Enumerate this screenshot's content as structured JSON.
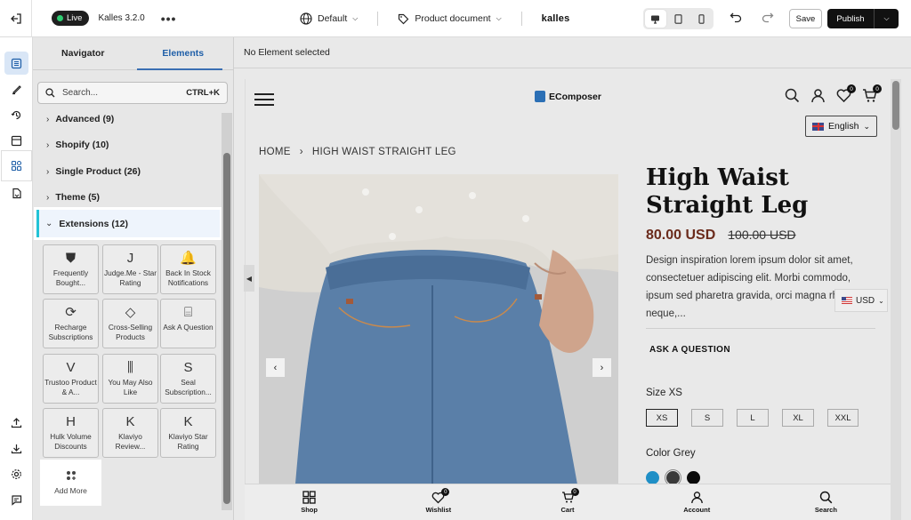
{
  "topbar": {
    "live_label": "Live",
    "theme_name": "Kalles 3.2.0",
    "more_label": "•••",
    "language_label": "Default",
    "page_label": "Product document",
    "brand_logo": "kalles",
    "save_label": "Save",
    "publish_label": "Publish"
  },
  "panel": {
    "tabs": [
      "Navigator",
      "Elements"
    ],
    "active_tab": "Elements",
    "search_placeholder": "Search...",
    "search_shortcut": "CTRL+K",
    "categories": [
      {
        "label": "Advanced (9)"
      },
      {
        "label": "Shopify (10)"
      },
      {
        "label": "Single Product (26)"
      },
      {
        "label": "Theme (5)"
      },
      {
        "label": "Extensions (12)"
      }
    ],
    "tiles": [
      {
        "label": "Frequently Bought...",
        "icon": "shield-icon",
        "glyph": "⛊"
      },
      {
        "label": "Judge.Me - Star Rating",
        "icon": "judgeme-icon",
        "glyph": "J"
      },
      {
        "label": "Back In Stock Notifications",
        "icon": "bell-icon",
        "glyph": "🔔"
      },
      {
        "label": "Recharge Subscriptions",
        "icon": "refresh-icon",
        "glyph": "⟳"
      },
      {
        "label": "Cross-Selling Products",
        "icon": "tag-icon",
        "glyph": "◇"
      },
      {
        "label": "Ask A Question",
        "icon": "chat-icon",
        "glyph": "⌸"
      },
      {
        "label": "Trustoo Product & A...",
        "icon": "trustoo-icon",
        "glyph": "V"
      },
      {
        "label": "You May Also Like",
        "icon": "carousel-icon",
        "glyph": "⫼"
      },
      {
        "label": "Seal Subscription...",
        "icon": "seal-icon",
        "glyph": "S"
      },
      {
        "label": "Hulk Volume Discounts",
        "icon": "hulk-icon",
        "glyph": "H"
      },
      {
        "label": "Klaviyo Review...",
        "icon": "klaviyo-icon",
        "glyph": "K"
      },
      {
        "label": "Klaviyo Star Rating",
        "icon": "klaviyo-star-icon",
        "glyph": "K"
      }
    ],
    "add_more_label": "Add More"
  },
  "canvas": {
    "status": "No Element selected"
  },
  "store": {
    "logo_text": "EComposer",
    "wishlist_count": "0",
    "cart_count": "0",
    "language": "English",
    "breadcrumb": [
      "HOME",
      "HIGH WAIST STRAIGHT LEG"
    ],
    "product_title": "High Waist Straight Leg",
    "price_now": "80.00 USD",
    "price_old": "100.00 USD",
    "description": "Design inspiration lorem ipsum dolor sit amet, consectetuer adipiscing elit. Morbi commodo, ipsum sed pharetra gravida, orci magna rhoncus neque,...",
    "ask_question": "ASK A QUESTION",
    "currency": "USD",
    "size_label": "Size XS",
    "sizes": [
      "XS",
      "S",
      "L",
      "XL",
      "XXL"
    ],
    "selected_size": "XS",
    "color_label": "Color Grey",
    "swatches": [
      "#1f8fc6",
      "#3a3a3a",
      "#0a0a0a"
    ],
    "bottom_nav": [
      {
        "label": "Shop",
        "icon": "grid-icon"
      },
      {
        "label": "Wishlist",
        "icon": "heart-icon",
        "count": "0"
      },
      {
        "label": "Cart",
        "icon": "cart-icon",
        "count": "0"
      },
      {
        "label": "Account",
        "icon": "user-icon"
      },
      {
        "label": "Search",
        "icon": "search-icon"
      }
    ]
  },
  "colors": {
    "accent": "#3a6fb3",
    "highlight_bar": "#22c3d6",
    "price": "#6b2b1c",
    "live_dot": "#2ecc71"
  }
}
